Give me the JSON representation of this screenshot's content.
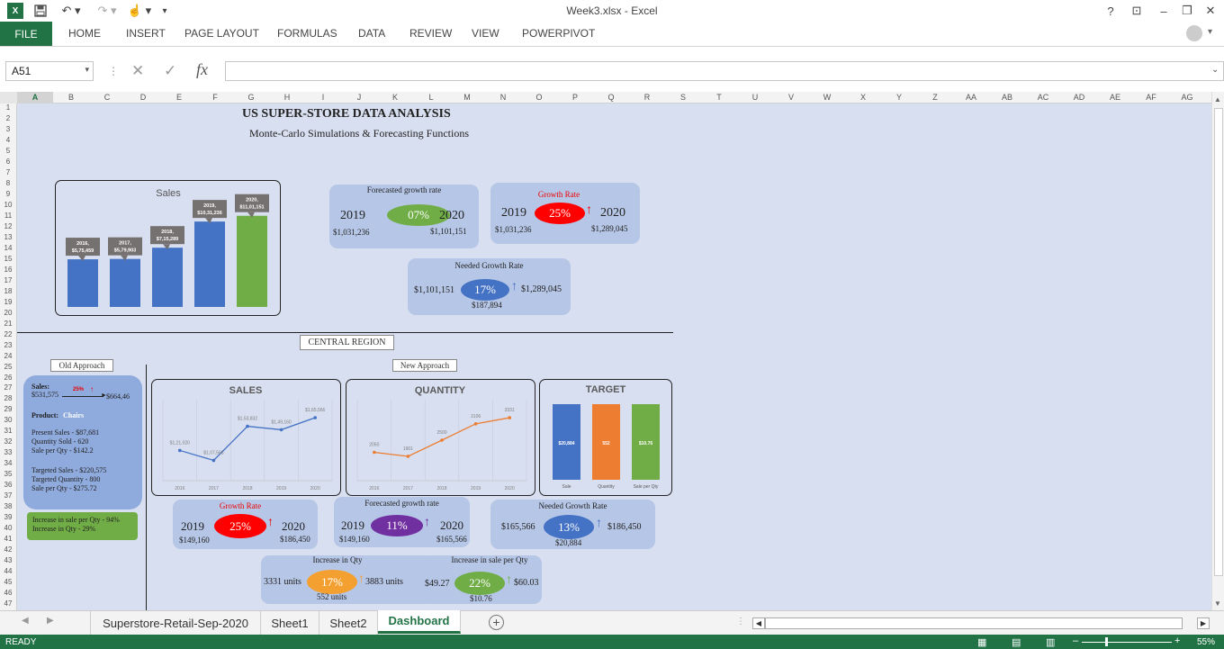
{
  "window": {
    "title": "Week3.xlsx - Excel",
    "help": "?",
    "ribbon_toggle": "⊡",
    "minimize": "–",
    "restore": "❐",
    "close": "✕"
  },
  "quick_access": {
    "app_icon": "excel-icon",
    "save": "save-icon",
    "undo": "undo-icon",
    "redo": "redo-icon",
    "touch": "touch-mode-icon"
  },
  "ribbon": {
    "tabs": [
      "FILE",
      "HOME",
      "INSERT",
      "PAGE LAYOUT",
      "FORMULAS",
      "DATA",
      "REVIEW",
      "VIEW",
      "POWERPIVOT"
    ]
  },
  "formula_bar": {
    "name_box": "A51",
    "cancel": "✕",
    "enter": "✓",
    "fx": "fx",
    "value": ""
  },
  "columns": [
    "A",
    "B",
    "C",
    "D",
    "E",
    "F",
    "G",
    "H",
    "I",
    "J",
    "K",
    "L",
    "M",
    "N",
    "O",
    "P",
    "Q",
    "R",
    "S",
    "T",
    "U",
    "V",
    "W",
    "X",
    "Y",
    "Z",
    "AA",
    "AB",
    "AC",
    "AD",
    "AE",
    "AF",
    "AG"
  ],
  "rows": [
    "1",
    "2",
    "3",
    "4",
    "5",
    "6",
    "7",
    "8",
    "9",
    "10",
    "11",
    "12",
    "13",
    "14",
    "15",
    "16",
    "17",
    "18",
    "19",
    "20",
    "21",
    "22",
    "23",
    "24",
    "25",
    "26",
    "27",
    "28",
    "29",
    "30",
    "31",
    "32",
    "33",
    "34",
    "35",
    "36",
    "37",
    "38",
    "39",
    "40",
    "41",
    "42",
    "43",
    "44",
    "45",
    "46",
    "47"
  ],
  "dashboard": {
    "title": "US SUPER-STORE DATA ANALYSIS",
    "subtitle": "Monte-Carlo Simulations & Forecasting Functions",
    "forecast_card": {
      "title": "Forecasted growth rate",
      "from_year": "2019",
      "to_year": "2020",
      "rate": "07%",
      "from_value": "$1,031,236",
      "to_value": "$1,101,151"
    },
    "growth_card": {
      "title": "Growth Rate",
      "from_year": "2019",
      "to_year": "2020",
      "rate": "25%",
      "from_value": "$1,031,236",
      "to_value": "$1,289,045"
    },
    "needed_card": {
      "title": "Needed Growth Rate",
      "rate": "17%",
      "from_value": "$1,101,151",
      "to_value": "$1,289,045",
      "diff": "$187,894"
    },
    "region_label": "CENTRAL REGION",
    "old_approach_label": "Old Approach",
    "new_approach_label": "New Approach",
    "old_card": {
      "sales_label": "Sales:",
      "sales_from": "$531,575",
      "sales_pct": "25%",
      "sales_to": "$664,46",
      "product_label": "Product:",
      "product_value": "Chairs",
      "present_sales": "Present Sales - $87,681",
      "qty_sold": "Quantity Sold - 620",
      "sale_per_qty": "Sale per Qty - $142.2",
      "target_sales": "Targeted Sales - $220,575",
      "target_qty": "Targeted Quantity - 800",
      "target_sale_per_qty": "Sale per Qty - $275.72"
    },
    "increase_card": {
      "line1": "Increase in sale per Qty - 94%",
      "line2": "Increase in Qty - 29%"
    },
    "c_growth": {
      "title": "Growth Rate",
      "from_year": "2019",
      "to_year": "2020",
      "rate": "25%",
      "from_value": "$149,160",
      "to_value": "$186,450"
    },
    "c_forecast": {
      "title": "Forecasted growth rate",
      "from_year": "2019",
      "to_year": "2020",
      "rate": "11%",
      "from_value": "$149,160",
      "to_value": "$165,566"
    },
    "c_needed": {
      "title": "Needed Growth Rate",
      "rate": "13%",
      "from_value": "$165,566",
      "to_value": "$186,450",
      "diff": "$20,884"
    },
    "c_qty": {
      "title": "Increase in Qty",
      "rate": "17%",
      "from_value": "3331 units",
      "to_value": "3883 units",
      "diff": "552 units"
    },
    "c_sale_qty": {
      "title": "Increase in sale per Qty",
      "rate": "22%",
      "from_value": "$49.27",
      "to_value": "$60.03",
      "diff": "$10.76"
    }
  },
  "colors": {
    "excel_green": "#217346",
    "bar_blue": "#4472c4",
    "bar_green": "#70ad47",
    "orange": "#ed7d31",
    "red": "#ff0000",
    "purple": "#7030a0",
    "pill_green": "#70ad47",
    "pill_orange": "#f4a030",
    "pill_blue": "#4472c4",
    "card": "#b6c6e6",
    "sheet_bg": "#d8dff0"
  },
  "chart_data": [
    {
      "type": "bar",
      "title": "Sales",
      "categories": [
        "2016",
        "2017",
        "2018",
        "2019",
        "2020"
      ],
      "values": [
        575459,
        579903,
        715289,
        1031236,
        1101151
      ],
      "data_labels": [
        "2016, $5,75,459",
        "2017, $5,79,903",
        "2018, $7,15,289",
        "2019, $10,31,236",
        "2020, $11,01,151"
      ],
      "ylim": [
        0,
        1200000
      ],
      "grid": false
    },
    {
      "type": "line",
      "title": "SALES",
      "categories": [
        "2016",
        "2017",
        "2018",
        "2019",
        "2020"
      ],
      "values": [
        121020,
        107563,
        153832,
        149160,
        165566
      ],
      "data_labels": [
        "$1,21,020",
        "$1,07,563",
        "$1,53,832",
        "$1,49,160",
        "$1,65,566"
      ],
      "ylim": [
        80000,
        190000
      ],
      "grid": true
    },
    {
      "type": "line",
      "title": "QUANTITY",
      "categories": [
        "2016",
        "2017",
        "2018",
        "2019",
        "2020"
      ],
      "values": [
        2050,
        1901,
        2500,
        3106,
        3331
      ],
      "data_labels": [
        "2050",
        "1901",
        "2500",
        "3106",
        "3331"
      ],
      "ylim": [
        1000,
        4000
      ],
      "grid": true
    },
    {
      "type": "bar",
      "title": "TARGET",
      "categories": [
        "Sale",
        "Quantity",
        "Sale per Qty"
      ],
      "values": [
        20884,
        552,
        10.76
      ],
      "data_labels": [
        "$20,884",
        "552",
        "$10.76"
      ],
      "grid": false
    }
  ],
  "sheet_tabs": {
    "tabs": [
      "Superstore-Retail-Sep-2020",
      "Sheet1",
      "Sheet2",
      "Dashboard"
    ],
    "active": "Dashboard",
    "add": "+"
  },
  "status": {
    "ready": "READY",
    "zoom": "55%",
    "minus": "–",
    "plus": "+"
  }
}
